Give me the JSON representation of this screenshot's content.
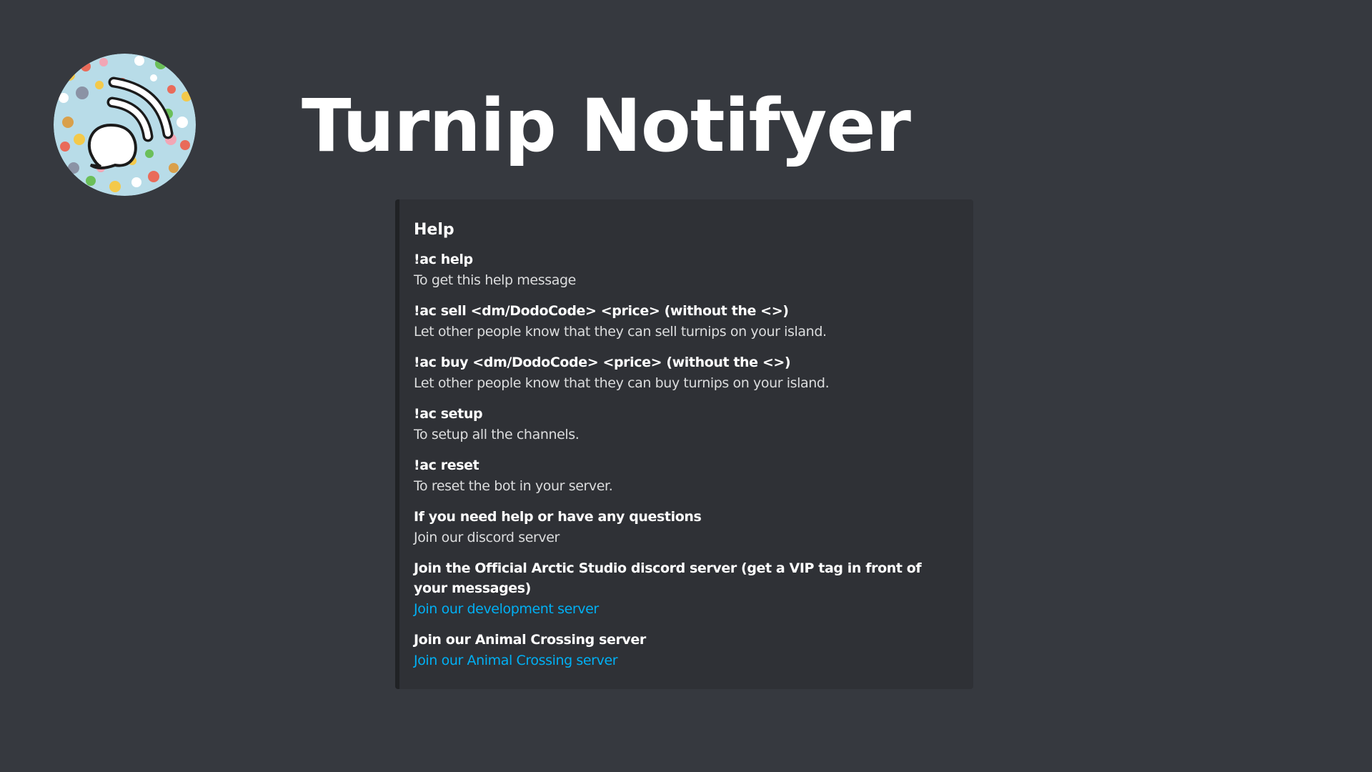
{
  "header": {
    "title": "Turnip Notifyer",
    "logo_icon": "turnip-notifyer-logo-icon"
  },
  "embed": {
    "title": "Help",
    "accent_color": "#202225",
    "fields": [
      {
        "name": "!ac help",
        "value": "To get this help message",
        "is_link": false
      },
      {
        "name": "!ac sell <dm/DodoCode> <price> (without the <>)",
        "value": "Let other people know that they can sell turnips on your island.",
        "is_link": false
      },
      {
        "name": "!ac buy <dm/DodoCode> <price> (without the <>)",
        "value": "Let other people know that they can buy turnips on your island.",
        "is_link": false
      },
      {
        "name": "!ac setup",
        "value": "To setup all the channels.",
        "is_link": false
      },
      {
        "name": "!ac reset",
        "value": "To reset the bot in your server.",
        "is_link": false
      },
      {
        "name": "If you need help or have any questions",
        "value": "Join our discord server",
        "is_link": false
      },
      {
        "name": "Join the Official Arctic Studio discord server (get a VIP tag in front of your messages)",
        "value": "Join our development server",
        "is_link": true
      },
      {
        "name": "Join our Animal Crossing server",
        "value": "Join our Animal Crossing server",
        "is_link": true
      }
    ]
  },
  "colors": {
    "background": "#36393f",
    "embed_background": "#2f3136",
    "link": "#00b0f4",
    "text": "#dcddde"
  }
}
